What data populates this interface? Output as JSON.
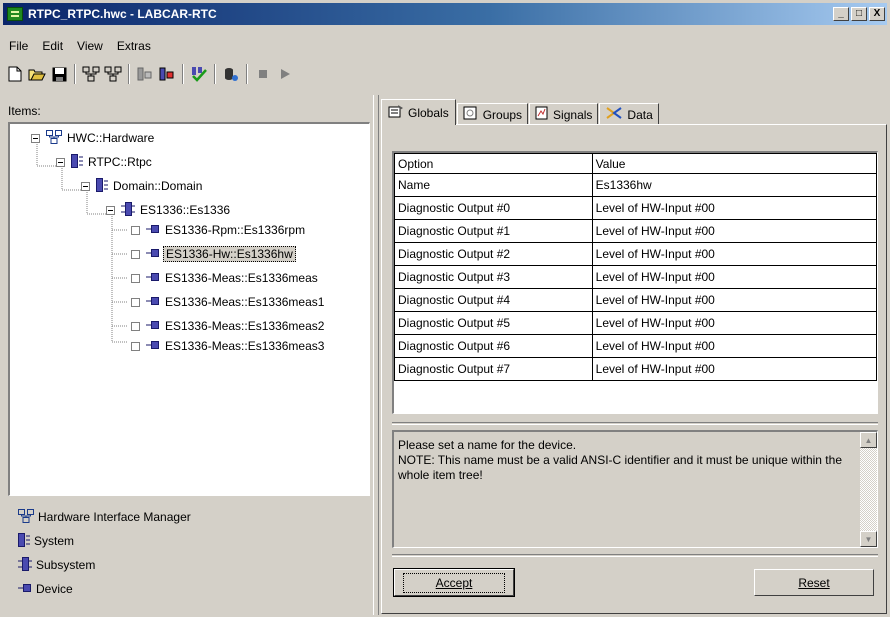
{
  "window": {
    "title": "RTPC_RTPC.hwc - LABCAR-RTC",
    "controls": [
      "_",
      "□",
      "X"
    ]
  },
  "menu": [
    "File",
    "Edit",
    "View",
    "Extras"
  ],
  "toolbar": {
    "icons": [
      "new-file-icon",
      "open-folder-icon",
      "save-icon",
      "hardware-icon",
      "hardware-add-icon",
      "import-icon",
      "export-icon",
      "check-icon",
      "database-icon",
      "stop-icon",
      "play-icon"
    ]
  },
  "items_panel": {
    "label": "Items:",
    "tree": [
      {
        "label": "HWC::Hardware",
        "type": "hardware",
        "level": 0
      },
      {
        "label": "RTPC::Rtpc",
        "type": "system",
        "level": 1
      },
      {
        "label": "Domain::Domain",
        "type": "system",
        "level": 2
      },
      {
        "label": "ES1336::Es1336",
        "type": "subsystem",
        "level": 3
      },
      {
        "label": "ES1336-Rpm::Es1336rpm",
        "type": "device",
        "level": 4
      },
      {
        "label": "ES1336-Hw::Es1336hw",
        "type": "device",
        "level": 4,
        "selected": true
      },
      {
        "label": "ES1336-Meas::Es1336meas",
        "type": "device",
        "level": 4
      },
      {
        "label": "ES1336-Meas::Es1336meas1",
        "type": "device",
        "level": 4
      },
      {
        "label": "ES1336-Meas::Es1336meas2",
        "type": "device",
        "level": 4
      },
      {
        "label": "ES1336-Meas::Es1336meas3",
        "type": "device",
        "level": 4
      }
    ],
    "legend": [
      {
        "label": "Hardware Interface Manager",
        "type": "hardware"
      },
      {
        "label": "System",
        "type": "system"
      },
      {
        "label": "Subsystem",
        "type": "subsystem"
      },
      {
        "label": "Device",
        "type": "device"
      }
    ]
  },
  "tabs": [
    {
      "label": "Globals",
      "icon": "globals-icon",
      "active": true
    },
    {
      "label": "Groups",
      "icon": "groups-icon",
      "active": false
    },
    {
      "label": "Signals",
      "icon": "signals-icon",
      "active": false
    },
    {
      "label": "Data",
      "icon": "data-icon",
      "active": false
    }
  ],
  "options_table": {
    "headers": [
      "Option",
      "Value"
    ],
    "rows": [
      [
        "Name",
        "Es1336hw"
      ],
      [
        "Diagnostic Output #0",
        "Level of HW-Input #00"
      ],
      [
        "Diagnostic Output #1",
        "Level of HW-Input #00"
      ],
      [
        "Diagnostic Output #2",
        "Level of HW-Input #00"
      ],
      [
        "Diagnostic Output #3",
        "Level of HW-Input #00"
      ],
      [
        "Diagnostic Output #4",
        "Level of HW-Input #00"
      ],
      [
        "Diagnostic Output #5",
        "Level of HW-Input #00"
      ],
      [
        "Diagnostic Output #6",
        "Level of HW-Input #00"
      ],
      [
        "Diagnostic Output #7",
        "Level of HW-Input #00"
      ]
    ]
  },
  "description": "Please set a name for the device.\nNOTE: This name must be a valid ANSI-C identifier and it must be unique within the whole item tree!",
  "buttons": {
    "accept": "Accept",
    "reset": "Reset"
  }
}
